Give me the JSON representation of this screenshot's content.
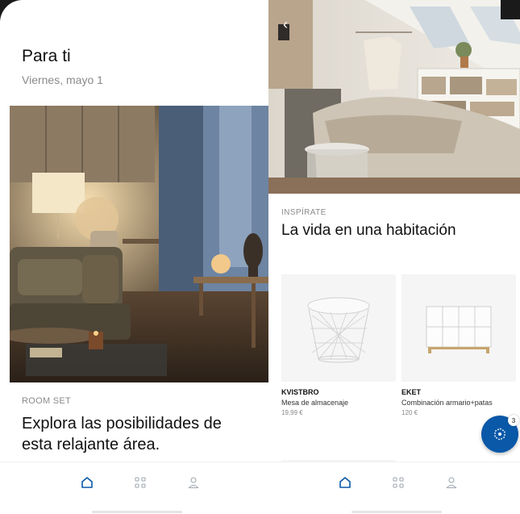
{
  "left_screen": {
    "title": "Para ti",
    "date": "Viernes, mayo 1",
    "image": "living-room-photo",
    "kicker": "ROOM SET",
    "headline": "Explora las posibilidades de esta relajante área."
  },
  "right_screen": {
    "image": "bedroom-photo",
    "kicker": "INSPÍRATE",
    "headline": "La vida en una habitación",
    "products": [
      {
        "name": "KVISTBRO",
        "description": "Mesa de almacenaje",
        "price": "19,99 €",
        "icon": "wire-basket-table"
      },
      {
        "name": "EKET",
        "description": "Combinación armario+patas",
        "price": "120 €",
        "icon": "cube-shelf-unit"
      }
    ],
    "fab_badge": "3",
    "fab_icon": "ar-view-icon"
  },
  "nav": {
    "items": [
      {
        "icon": "home-icon",
        "active": true
      },
      {
        "icon": "grid-icon",
        "active": false
      },
      {
        "icon": "profile-icon",
        "active": false
      }
    ]
  },
  "colors": {
    "accent": "#0a58a8",
    "nav_active": "#0a58a8",
    "nav_inactive": "#a0a8b0",
    "muted": "#8a8a8a"
  }
}
